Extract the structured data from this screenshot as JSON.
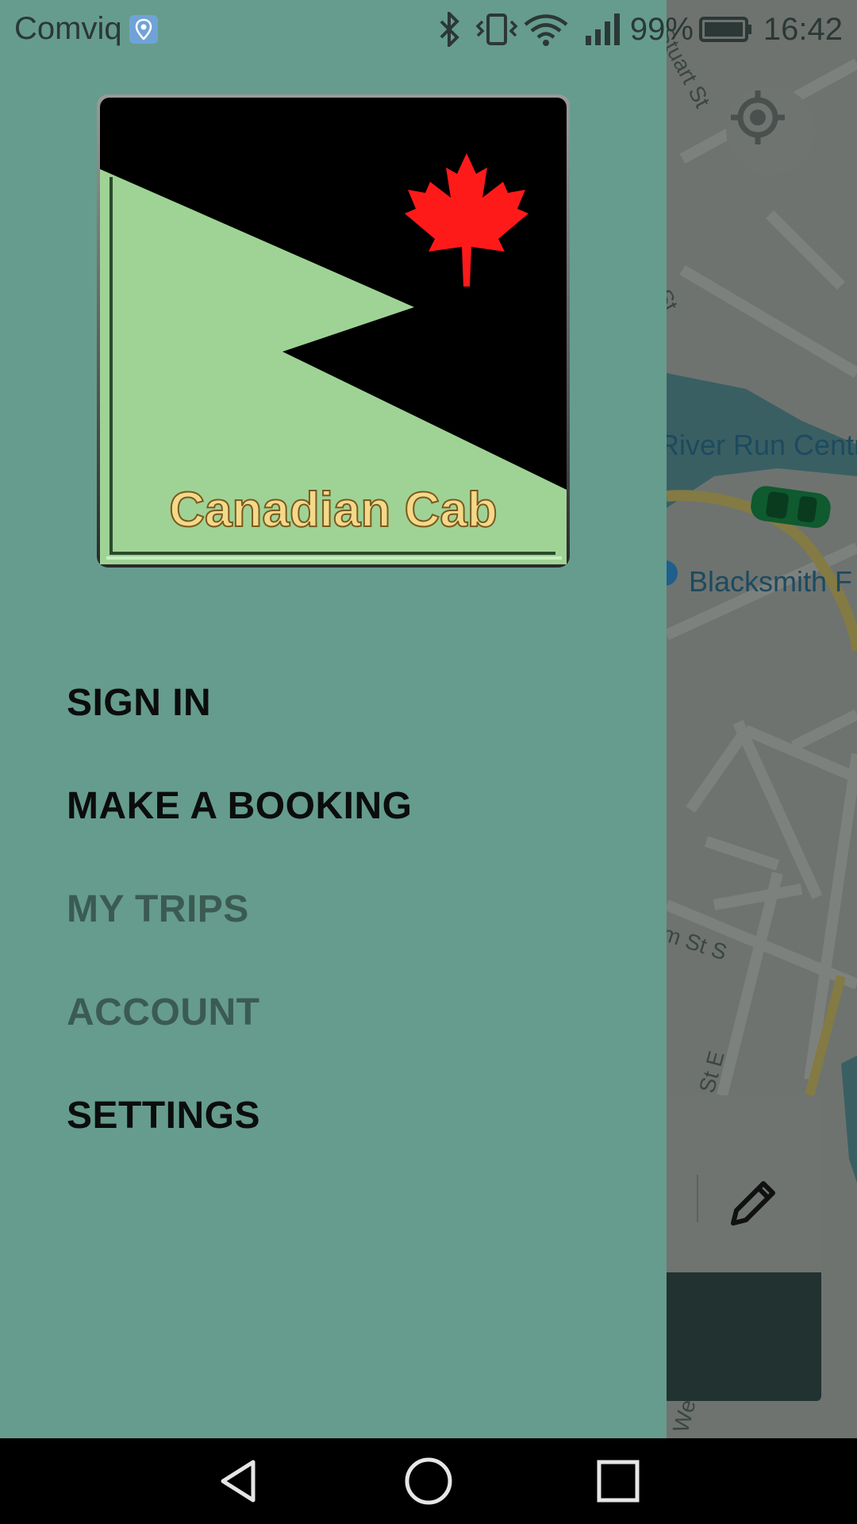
{
  "status_bar": {
    "carrier": "Comviq",
    "battery_percent": "99%",
    "time": "16:42",
    "icons": [
      "location-icon",
      "bluetooth-icon",
      "vibrate-icon",
      "wifi-icon",
      "signal-icon",
      "battery-icon"
    ]
  },
  "logo": {
    "text": "Canadian Cab",
    "icon": "maple-leaf-icon"
  },
  "menu": {
    "items": [
      {
        "label": "SIGN IN",
        "enabled": true
      },
      {
        "label": "MAKE A BOOKING",
        "enabled": true
      },
      {
        "label": "MY TRIPS",
        "enabled": false
      },
      {
        "label": "ACCOUNT",
        "enabled": false
      },
      {
        "label": "SETTINGS",
        "enabled": true
      }
    ]
  },
  "map": {
    "labels": {
      "street_stuart": "Stuart St",
      "street_s": "s St",
      "poi_river_run": "River Run Centr",
      "poi_blacksmith": "Blacksmith F",
      "street_m_st_s": "m St S",
      "street_st_e": "St E",
      "street_we": "We"
    },
    "icons": [
      "locate-me-icon",
      "car-icon",
      "pencil-icon"
    ]
  },
  "nav_bar": {
    "icons": [
      "back-icon",
      "home-icon",
      "recents-icon"
    ]
  },
  "colors": {
    "drawer_bg": "#669c8d",
    "logo_green": "#9fd395",
    "maple_red": "#ff1a1a",
    "logo_text": "#f5d98a"
  }
}
